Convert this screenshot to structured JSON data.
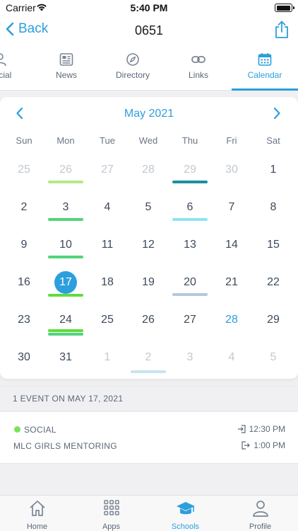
{
  "status": {
    "carrier": "Carrier",
    "time": "5:40 PM"
  },
  "nav": {
    "back_label": "Back",
    "title": "0651"
  },
  "tabs": [
    {
      "label": "Social",
      "icon": "people-icon"
    },
    {
      "label": "News",
      "icon": "newspaper-icon"
    },
    {
      "label": "Directory",
      "icon": "compass-icon"
    },
    {
      "label": "Links",
      "icon": "link-icon"
    },
    {
      "label": "Calendar",
      "icon": "calendar-icon",
      "active": true
    }
  ],
  "calendar": {
    "month": "May 2021",
    "weekdays": [
      "Sun",
      "Mon",
      "Tue",
      "Wed",
      "Thu",
      "Fri",
      "Sat"
    ],
    "weeks": [
      [
        "25",
        "26",
        "27",
        "28",
        "29",
        "30",
        "1"
      ],
      [
        "2",
        "3",
        "4",
        "5",
        "6",
        "7",
        "8"
      ],
      [
        "9",
        "10",
        "11",
        "12",
        "13",
        "14",
        "15"
      ],
      [
        "16",
        "17",
        "18",
        "19",
        "20",
        "21",
        "22"
      ],
      [
        "23",
        "24",
        "25",
        "26",
        "27",
        "28",
        "29"
      ],
      [
        "30",
        "31",
        "1",
        "2",
        "3",
        "4",
        "5"
      ]
    ],
    "selected_day": "17",
    "accent_day": "28",
    "event_colors": {
      "light_green": "#b5e88a",
      "teal": "#1a8fa0",
      "green": "#52d47a",
      "light_teal": "#8ee4ee",
      "bright_green": "#5fdc3f",
      "grey_blue": "#b4c8dc",
      "pale_blue": "#c8e4f0"
    }
  },
  "events": {
    "header": "1 EVENT ON MAY 17, 2021",
    "items": [
      {
        "category": "SOCIAL",
        "title": "MLC GIRLS MENTORING",
        "start": "12:30 PM",
        "end": "1:00 PM",
        "dot_color": "#7ce05a"
      }
    ]
  },
  "bottom_tabs": [
    {
      "label": "Home",
      "icon": "home-icon"
    },
    {
      "label": "Apps",
      "icon": "grid-icon"
    },
    {
      "label": "Schools",
      "icon": "graduation-cap-icon",
      "active": true
    },
    {
      "label": "Profile",
      "icon": "person-icon"
    }
  ],
  "colors": {
    "accent": "#2c9fdc",
    "text": "#3c4a5a",
    "muted": "#c2c8cf"
  }
}
